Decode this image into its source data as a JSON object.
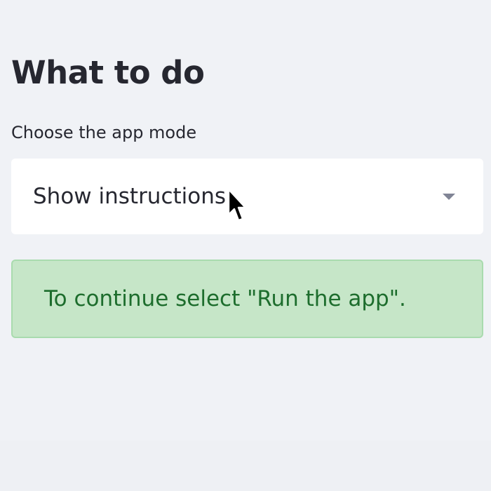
{
  "sidebar": {
    "heading": "What to do",
    "app_mode_select": {
      "label": "Choose the app mode",
      "selected_value": "Show instructions"
    },
    "alert": {
      "message": "To continue select \"Run the app\".",
      "type": "success"
    }
  },
  "icons": {
    "dropdown": "chevron-down-icon",
    "pointer": "cursor-icon"
  },
  "colors": {
    "background": "#f0f2f6",
    "text": "#262730",
    "alert_background": "#c6e6c8",
    "alert_border": "#a9dbae",
    "alert_text": "#1d6d2d"
  }
}
